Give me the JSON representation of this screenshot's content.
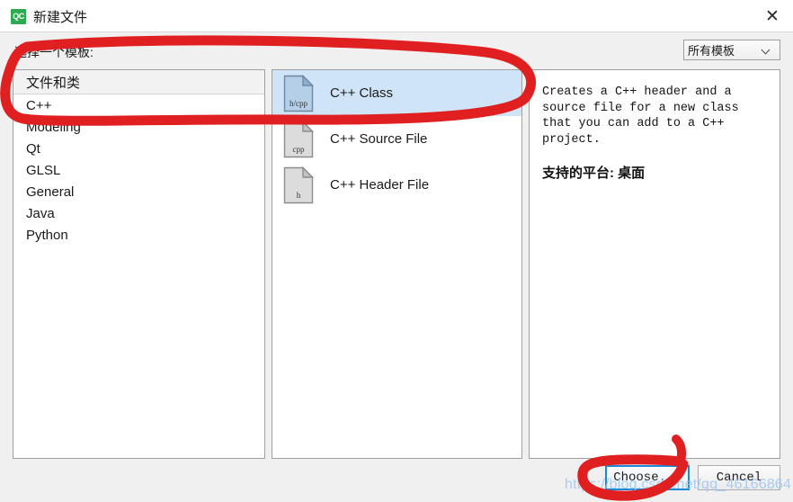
{
  "window": {
    "title": "新建文件",
    "app_icon_text": "QC",
    "close_icon": "close-icon"
  },
  "header": {
    "choose_template_label": "选择一个模板:",
    "filter": {
      "value": "所有模板",
      "chevron": "chevron-down-icon"
    }
  },
  "categories": {
    "group_label": "文件和类",
    "items": [
      {
        "label": "C++",
        "selected": true
      },
      {
        "label": "Modeling",
        "selected": false
      },
      {
        "label": "Qt",
        "selected": false
      },
      {
        "label": "GLSL",
        "selected": false
      },
      {
        "label": "General",
        "selected": false
      },
      {
        "label": "Java",
        "selected": false
      },
      {
        "label": "Python",
        "selected": false
      }
    ]
  },
  "templates": {
    "items": [
      {
        "label": "C++ Class",
        "ext": "h/cpp",
        "selected": true
      },
      {
        "label": "C++ Source File",
        "ext": "cpp",
        "selected": false
      },
      {
        "label": "C++ Header File",
        "ext": "h",
        "selected": false
      }
    ]
  },
  "description": {
    "text": "Creates a C++ header and a\nsource file for a new class\nthat you can add to a C++\nproject.",
    "platform": "支持的平台: 桌面"
  },
  "footer": {
    "choose_label": "Choose...",
    "cancel_label": "Cancel"
  },
  "watermark": {
    "text": "https://blog.csdn.net/qq_46166864"
  },
  "colors": {
    "selection_blue": "#cfe5f7",
    "default_button_border": "#1e88d8",
    "annotation_red": "#e02020",
    "app_icon_green": "#2eaa52",
    "dialog_background": "#f0f0f0"
  }
}
